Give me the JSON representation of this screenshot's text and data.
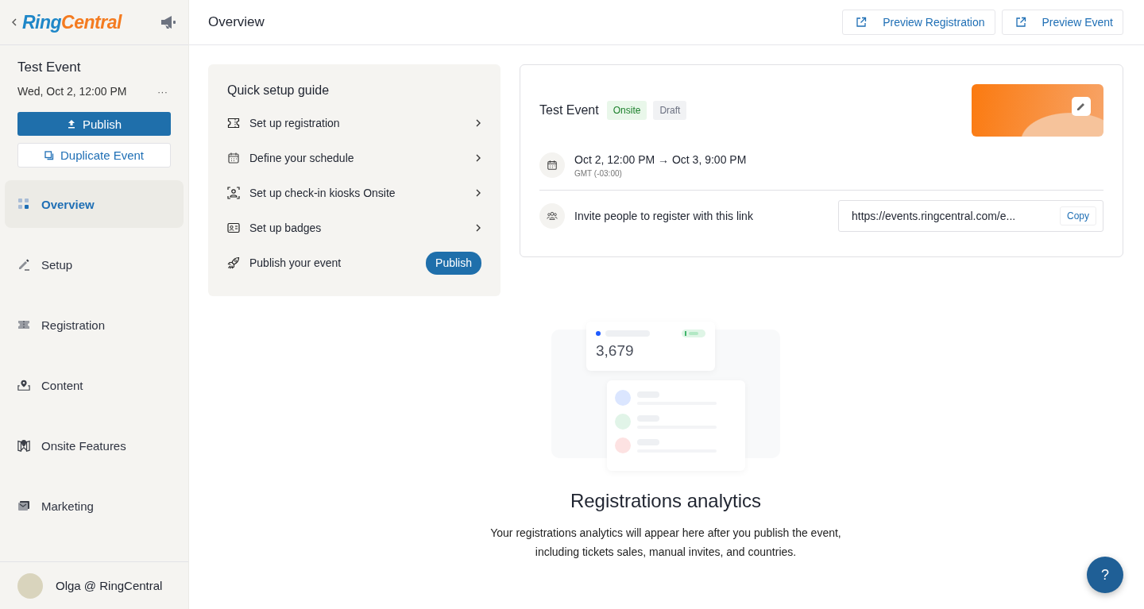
{
  "sidebar": {
    "logo": [
      "Ring",
      "Central"
    ],
    "event": {
      "title": "Test Event",
      "datetime": "Wed, Oct 2, 12:00 PM",
      "more": "···"
    },
    "publish_button": "Publish",
    "duplicate_button": "Duplicate Event",
    "nav": [
      {
        "label": "Overview",
        "selected": true
      },
      {
        "label": "Setup",
        "selected": false
      },
      {
        "label": "Registration",
        "selected": false
      },
      {
        "label": "Content",
        "selected": false
      },
      {
        "label": "Onsite Features",
        "selected": false
      },
      {
        "label": "Marketing",
        "selected": false
      }
    ],
    "user": "Olga @ RingCentral"
  },
  "header": {
    "title": "Overview",
    "buttons": [
      "Preview Registration",
      "Preview Event"
    ]
  },
  "guide": {
    "title": "Quick setup guide",
    "steps": [
      {
        "label": "Set up registration",
        "kind": "link"
      },
      {
        "label": "Define your schedule",
        "kind": "link"
      },
      {
        "label": "Set up check-in kiosks Onsite",
        "kind": "link"
      },
      {
        "label": "Set up badges",
        "kind": "link"
      },
      {
        "label": "Publish your event",
        "kind": "button",
        "button": "Publish"
      }
    ]
  },
  "event_card": {
    "title": "Test Event",
    "tags": [
      {
        "label": "Onsite",
        "kind": "success"
      },
      {
        "label": "Draft",
        "kind": "neutral"
      }
    ],
    "dates": "Oct 2, 12:00 PM → Oct 3, 9:00 PM",
    "timezone": "GMT (-03:00)",
    "invite": "Invite people to register with this link",
    "link": "https://events.ringcentral.com/e...",
    "copy": "Copy"
  },
  "analytics": {
    "figure_number": "3,679",
    "title": "Registrations analytics",
    "text": "Your registrations analytics will appear here after you publish the event, including tickets sales, manual invites, and countries."
  },
  "help_button": "?"
}
